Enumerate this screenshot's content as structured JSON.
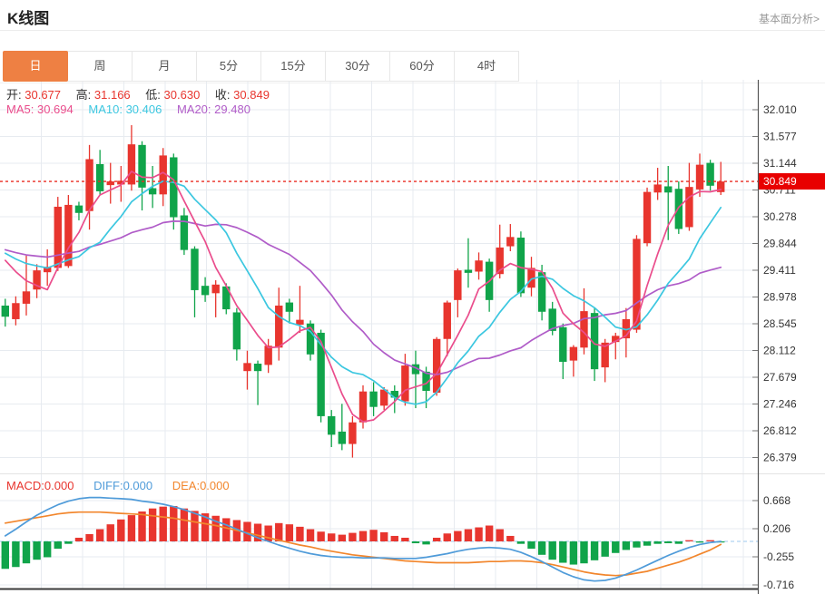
{
  "header": {
    "title": "K线图",
    "link": "基本面分析>"
  },
  "tabs": [
    {
      "label": "日",
      "active": true
    },
    {
      "label": "周",
      "active": false
    },
    {
      "label": "月",
      "active": false
    },
    {
      "label": "5分",
      "active": false
    },
    {
      "label": "15分",
      "active": false
    },
    {
      "label": "30分",
      "active": false
    },
    {
      "label": "60分",
      "active": false
    },
    {
      "label": "4时",
      "active": false
    }
  ],
  "legend": {
    "open_label": "开:",
    "open_value": "30.677",
    "high_label": "高:",
    "high_value": "31.166",
    "low_label": "低:",
    "low_value": "30.630",
    "close_label": "收:",
    "close_value": "30.849",
    "ma5_label": "MA5:",
    "ma5_value": "30.694",
    "ma10_label": "MA10:",
    "ma10_value": "30.406",
    "ma20_label": "MA20:",
    "ma20_value": "29.480"
  },
  "macd_legend": {
    "macd_label": "MACD:",
    "macd_value": "0.000",
    "diff_label": "DIFF:",
    "diff_value": "0.000",
    "dea_label": "DEA:",
    "dea_value": "0.000"
  },
  "price_badge": "30.849",
  "colors": {
    "up": "#e8352e",
    "down": "#10a44a",
    "ma5": "#ea4d8c",
    "ma10": "#3cc7e0",
    "ma20": "#b05cc8",
    "diff": "#4f9bd9",
    "dea": "#f2862c",
    "badge_bg": "#e80000",
    "tab_active_bg": "#ee8043",
    "grid": "#e7ebf0",
    "axis_line": "#555",
    "axis_text": "#333",
    "dashed_price": "#ea2b20",
    "zero_line": "#9ec9ef",
    "bottom_line": "#3a3a3a"
  },
  "chart_data": {
    "type": "candlestick_with_macd",
    "title": "K线图",
    "legend_position": "top-left",
    "grid": true,
    "y_axis_labels": [
      "32.010",
      "31.577",
      "31.144",
      "30.711",
      "30.278",
      "29.844",
      "29.411",
      "28.978",
      "28.545",
      "28.112",
      "27.679",
      "27.246",
      "26.812",
      "26.379"
    ],
    "y_axis_first_value": 32.01,
    "y_axis_step": 0.433,
    "current_price": 30.849,
    "last_ohlc": {
      "open": 30.677,
      "high": 31.166,
      "low": 30.63,
      "close": 30.849
    },
    "ma_periods": [
      5,
      10,
      20
    ],
    "ma_values_display": {
      "MA5": 30.694,
      "MA10": 30.406,
      "MA20": 29.48
    },
    "ma_history_seed": 29.8,
    "candles_ohlc": [
      [
        28.84,
        28.95,
        28.5,
        28.66
      ],
      [
        28.62,
        28.99,
        28.52,
        28.88
      ],
      [
        28.87,
        29.65,
        28.68,
        29.07
      ],
      [
        29.1,
        29.51,
        28.96,
        29.41
      ],
      [
        29.38,
        29.75,
        29.16,
        29.47
      ],
      [
        29.45,
        30.6,
        29.4,
        30.44
      ],
      [
        29.48,
        30.63,
        29.45,
        30.47
      ],
      [
        30.46,
        30.52,
        30.22,
        30.34
      ],
      [
        30.37,
        31.44,
        30.07,
        31.21
      ],
      [
        31.13,
        31.36,
        30.63,
        30.69
      ],
      [
        30.79,
        31.15,
        30.49,
        30.85
      ],
      [
        30.8,
        31.1,
        30.52,
        30.86
      ],
      [
        30.8,
        31.76,
        30.7,
        31.45
      ],
      [
        31.44,
        31.5,
        30.38,
        30.75
      ],
      [
        30.74,
        31.1,
        30.42,
        30.64
      ],
      [
        30.64,
        31.39,
        30.45,
        31.27
      ],
      [
        31.24,
        31.3,
        30.07,
        30.27
      ],
      [
        30.3,
        30.42,
        29.66,
        29.74
      ],
      [
        29.76,
        29.8,
        28.65,
        29.09
      ],
      [
        29.16,
        29.3,
        28.9,
        29.01
      ],
      [
        29.04,
        29.25,
        28.65,
        29.18
      ],
      [
        29.15,
        29.2,
        28.7,
        28.78
      ],
      [
        28.73,
        28.8,
        27.95,
        28.13
      ],
      [
        27.78,
        28.11,
        27.48,
        27.91
      ],
      [
        27.9,
        27.95,
        27.23,
        27.78
      ],
      [
        27.88,
        28.3,
        27.75,
        28.19
      ],
      [
        28.16,
        29.13,
        27.95,
        28.84
      ],
      [
        28.89,
        28.95,
        28.55,
        28.74
      ],
      [
        28.53,
        29.16,
        28.4,
        28.61
      ],
      [
        28.55,
        28.6,
        27.95,
        28.05
      ],
      [
        28.4,
        28.45,
        26.95,
        27.05
      ],
      [
        27.05,
        27.15,
        26.55,
        26.75
      ],
      [
        26.8,
        27.25,
        26.5,
        26.6
      ],
      [
        26.6,
        27.05,
        26.38,
        26.95
      ],
      [
        26.95,
        27.55,
        26.85,
        27.45
      ],
      [
        27.45,
        27.6,
        27.05,
        27.2
      ],
      [
        27.22,
        27.52,
        27.15,
        27.48
      ],
      [
        27.46,
        27.55,
        27.1,
        27.35
      ],
      [
        27.29,
        28.06,
        27.22,
        27.87
      ],
      [
        27.89,
        28.11,
        27.18,
        27.73
      ],
      [
        27.77,
        27.85,
        27.18,
        27.46
      ],
      [
        27.43,
        28.33,
        27.38,
        28.3
      ],
      [
        28.3,
        28.92,
        28.02,
        28.89
      ],
      [
        28.93,
        29.44,
        28.65,
        29.41
      ],
      [
        29.42,
        29.93,
        29.13,
        29.37
      ],
      [
        29.39,
        29.7,
        29.26,
        29.57
      ],
      [
        29.55,
        29.6,
        28.74,
        28.93
      ],
      [
        29.35,
        30.15,
        29.28,
        29.78
      ],
      [
        29.8,
        30.16,
        29.72,
        29.95
      ],
      [
        29.94,
        30.04,
        28.98,
        29.04
      ],
      [
        29.13,
        29.63,
        28.99,
        29.45
      ],
      [
        29.38,
        29.5,
        28.6,
        28.74
      ],
      [
        28.79,
        28.9,
        28.36,
        28.43
      ],
      [
        28.49,
        28.55,
        27.65,
        27.93
      ],
      [
        27.95,
        28.2,
        27.69,
        28.17
      ],
      [
        28.16,
        29.12,
        28.05,
        28.75
      ],
      [
        28.72,
        28.8,
        27.62,
        27.81
      ],
      [
        27.84,
        28.3,
        27.6,
        28.24
      ],
      [
        28.25,
        28.4,
        27.97,
        28.35
      ],
      [
        28.31,
        28.8,
        28.0,
        28.62
      ],
      [
        28.45,
        29.98,
        28.4,
        29.92
      ],
      [
        29.85,
        30.75,
        29.8,
        30.68
      ],
      [
        30.67,
        31.07,
        30.55,
        30.8
      ],
      [
        30.77,
        31.1,
        29.9,
        30.67
      ],
      [
        30.73,
        30.85,
        30.0,
        30.08
      ],
      [
        30.11,
        31.15,
        30.05,
        30.76
      ],
      [
        30.72,
        31.3,
        30.6,
        31.12
      ],
      [
        31.15,
        31.2,
        30.7,
        30.78
      ],
      [
        30.677,
        31.166,
        30.63,
        30.849
      ]
    ],
    "macd": {
      "y_axis_labels": [
        "0.668",
        "0.206",
        "-0.255",
        "-0.716"
      ],
      "displayed_values": {
        "MACD": 0.0,
        "DIFF": 0.0,
        "DEA": 0.0
      },
      "hist": [
        -0.45,
        -0.42,
        -0.36,
        -0.3,
        -0.26,
        -0.12,
        -0.04,
        0.06,
        0.12,
        0.2,
        0.28,
        0.36,
        0.43,
        0.49,
        0.54,
        0.57,
        0.58,
        0.54,
        0.5,
        0.46,
        0.42,
        0.38,
        0.35,
        0.32,
        0.29,
        0.26,
        0.3,
        0.28,
        0.24,
        0.2,
        0.16,
        0.13,
        0.11,
        0.14,
        0.17,
        0.19,
        0.15,
        0.09,
        0.06,
        -0.03,
        -0.05,
        0.06,
        0.13,
        0.17,
        0.2,
        0.23,
        0.26,
        0.2,
        0.09,
        -0.04,
        -0.12,
        -0.22,
        -0.3,
        -0.35,
        -0.38,
        -0.36,
        -0.31,
        -0.25,
        -0.19,
        -0.14,
        -0.1,
        -0.07,
        -0.04,
        -0.03,
        -0.04,
        0.02,
        -0.02,
        0.02,
        -0.01
      ],
      "diff": [
        0.09,
        0.2,
        0.32,
        0.43,
        0.52,
        0.6,
        0.66,
        0.7,
        0.72,
        0.72,
        0.71,
        0.7,
        0.69,
        0.66,
        0.64,
        0.61,
        0.57,
        0.52,
        0.46,
        0.4,
        0.33,
        0.27,
        0.2,
        0.13,
        0.06,
        0.0,
        -0.06,
        -0.11,
        -0.16,
        -0.2,
        -0.23,
        -0.25,
        -0.26,
        -0.26,
        -0.27,
        -0.27,
        -0.27,
        -0.28,
        -0.28,
        -0.28,
        -0.26,
        -0.23,
        -0.2,
        -0.16,
        -0.13,
        -0.11,
        -0.1,
        -0.11,
        -0.13,
        -0.18,
        -0.25,
        -0.33,
        -0.42,
        -0.51,
        -0.58,
        -0.63,
        -0.65,
        -0.64,
        -0.6,
        -0.54,
        -0.47,
        -0.39,
        -0.31,
        -0.23,
        -0.16,
        -0.1,
        -0.05,
        -0.02,
        0.0
      ],
      "dea": [
        0.3,
        0.33,
        0.36,
        0.39,
        0.42,
        0.45,
        0.47,
        0.48,
        0.48,
        0.48,
        0.47,
        0.46,
        0.45,
        0.44,
        0.42,
        0.4,
        0.38,
        0.35,
        0.32,
        0.29,
        0.26,
        0.22,
        0.18,
        0.14,
        0.1,
        0.06,
        0.02,
        -0.02,
        -0.06,
        -0.09,
        -0.13,
        -0.16,
        -0.19,
        -0.22,
        -0.24,
        -0.26,
        -0.28,
        -0.3,
        -0.32,
        -0.33,
        -0.34,
        -0.35,
        -0.35,
        -0.35,
        -0.35,
        -0.34,
        -0.33,
        -0.33,
        -0.32,
        -0.32,
        -0.33,
        -0.35,
        -0.38,
        -0.42,
        -0.46,
        -0.5,
        -0.53,
        -0.55,
        -0.56,
        -0.55,
        -0.52,
        -0.49,
        -0.44,
        -0.39,
        -0.34,
        -0.28,
        -0.21,
        -0.14,
        -0.05
      ]
    }
  }
}
